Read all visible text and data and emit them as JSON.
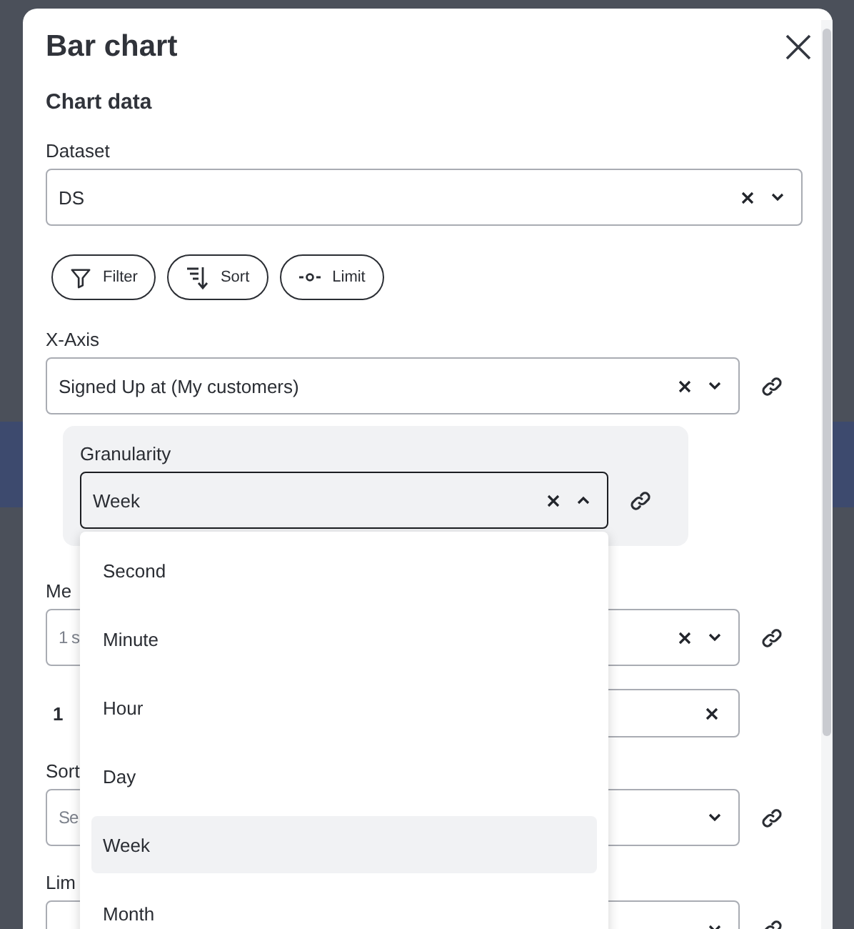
{
  "dialog": {
    "title": "Bar chart",
    "section": "Chart data"
  },
  "dataset": {
    "label": "Dataset",
    "value": "DS",
    "clearable": true,
    "linked": false,
    "open": false
  },
  "query_buttons": [
    {
      "kind": "filter",
      "label": "Filter"
    },
    {
      "kind": "sort",
      "label": "Sort"
    },
    {
      "kind": "limit",
      "label": "Limit"
    }
  ],
  "x_axis": {
    "label": "X-Axis",
    "value": "Signed Up at (My customers)",
    "clearable": true,
    "linked": true,
    "open": false
  },
  "granularity": {
    "label": "Granularity",
    "value": "Week",
    "clearable": true,
    "linked": true,
    "open": true
  },
  "metric": {
    "label": "Me",
    "placeholder": "1 s",
    "clearable": true,
    "linked": true,
    "open": false
  },
  "metric_item": {
    "index": "1",
    "clearable": true
  },
  "sort": {
    "label": "Sort",
    "placeholder": "Se",
    "clearable": false,
    "linked": true,
    "open": false
  },
  "limit": {
    "label": "Lim",
    "clearable": false,
    "linked": true,
    "open": false
  },
  "dropdown_options": [
    {
      "label": "Second",
      "selected": false
    },
    {
      "label": "Minute",
      "selected": false
    },
    {
      "label": "Hour",
      "selected": false
    },
    {
      "label": "Day",
      "selected": false
    },
    {
      "label": "Week",
      "selected": true
    },
    {
      "label": "Month",
      "selected": false
    }
  ]
}
